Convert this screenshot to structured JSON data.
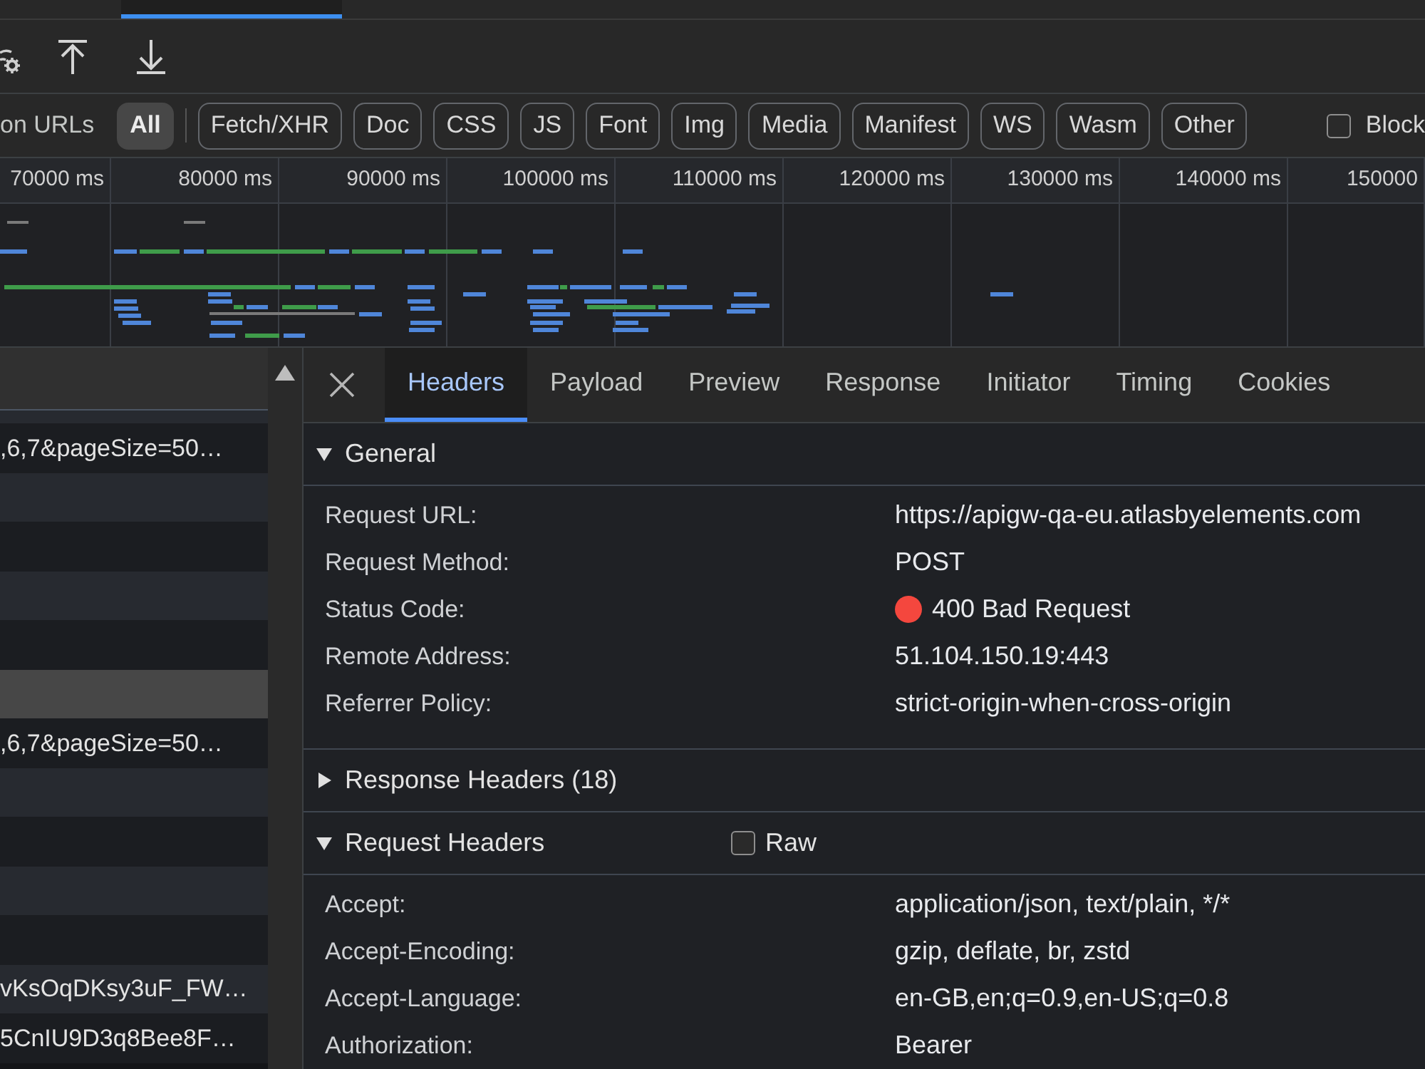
{
  "top_tabs": [
    {
      "selected": true
    }
  ],
  "filter_bar": {
    "label": "on URLs",
    "chips": [
      {
        "label": "All",
        "selected": true
      },
      {
        "label": "Fetch/XHR",
        "selected": false
      },
      {
        "label": "Doc",
        "selected": false
      },
      {
        "label": "CSS",
        "selected": false
      },
      {
        "label": "JS",
        "selected": false
      },
      {
        "label": "Font",
        "selected": false
      },
      {
        "label": "Img",
        "selected": false
      },
      {
        "label": "Media",
        "selected": false
      },
      {
        "label": "Manifest",
        "selected": false
      },
      {
        "label": "WS",
        "selected": false
      },
      {
        "label": "Wasm",
        "selected": false
      },
      {
        "label": "Other",
        "selected": false
      }
    ],
    "block_checkbox": {
      "label": "Block",
      "checked": false
    }
  },
  "timeline": {
    "ticks": [
      "70000 ms",
      "80000 ms",
      "90000 ms",
      "100000 ms",
      "110000 ms",
      "120000 ms",
      "130000 ms",
      "140000 ms",
      "150000"
    ]
  },
  "request_list": {
    "rows": [
      {
        "name": ",6,7&pageSize=50…",
        "selected": false
      },
      {
        "selected": false
      },
      {
        "selected": false
      },
      {
        "selected": false
      },
      {
        "selected": false
      },
      {
        "selected": true
      },
      {
        "name": ",6,7&pageSize=50…",
        "selected": false
      },
      {
        "selected": false
      },
      {
        "selected": false
      },
      {
        "selected": false
      },
      {
        "selected": false
      },
      {
        "name": "vKsOqDKsy3uF_FW…",
        "selected": false
      },
      {
        "name": "5CnIU9D3q8Bee8F…",
        "selected": false
      }
    ]
  },
  "details": {
    "tabs": [
      {
        "label": "Headers",
        "selected": true
      },
      {
        "label": "Payload",
        "selected": false
      },
      {
        "label": "Preview",
        "selected": false
      },
      {
        "label": "Response",
        "selected": false
      },
      {
        "label": "Initiator",
        "selected": false
      },
      {
        "label": "Timing",
        "selected": false
      },
      {
        "label": "Cookies",
        "selected": false
      }
    ],
    "sections": [
      {
        "title": "General",
        "expanded": true,
        "rows": [
          {
            "label": "Request URL:",
            "value": "https://apigw-qa-eu.atlasbyelements.com"
          },
          {
            "label": "Request Method:",
            "value": "POST"
          },
          {
            "label": "Status Code:",
            "value": "400 Bad Request",
            "color": "#f4473e"
          },
          {
            "label": "Remote Address:",
            "value": "51.104.150.19:443"
          },
          {
            "label": "Referrer Policy:",
            "value": "strict-origin-when-cross-origin"
          }
        ]
      },
      {
        "title": "Response Headers (18)",
        "expanded": false
      },
      {
        "title": "Request Headers",
        "expanded": true,
        "raw_checkbox": {
          "label": "Raw",
          "checked": false
        },
        "rows": [
          {
            "label": "Accept:",
            "value": "application/json, text/plain, */*"
          },
          {
            "label": "Accept-Encoding:",
            "value": "gzip, deflate, br, zstd"
          },
          {
            "label": "Accept-Language:",
            "value": "en-GB,en;q=0.9,en-US;q=0.8"
          },
          {
            "label": "Authorization:",
            "value": "Bearer"
          }
        ]
      }
    ]
  }
}
